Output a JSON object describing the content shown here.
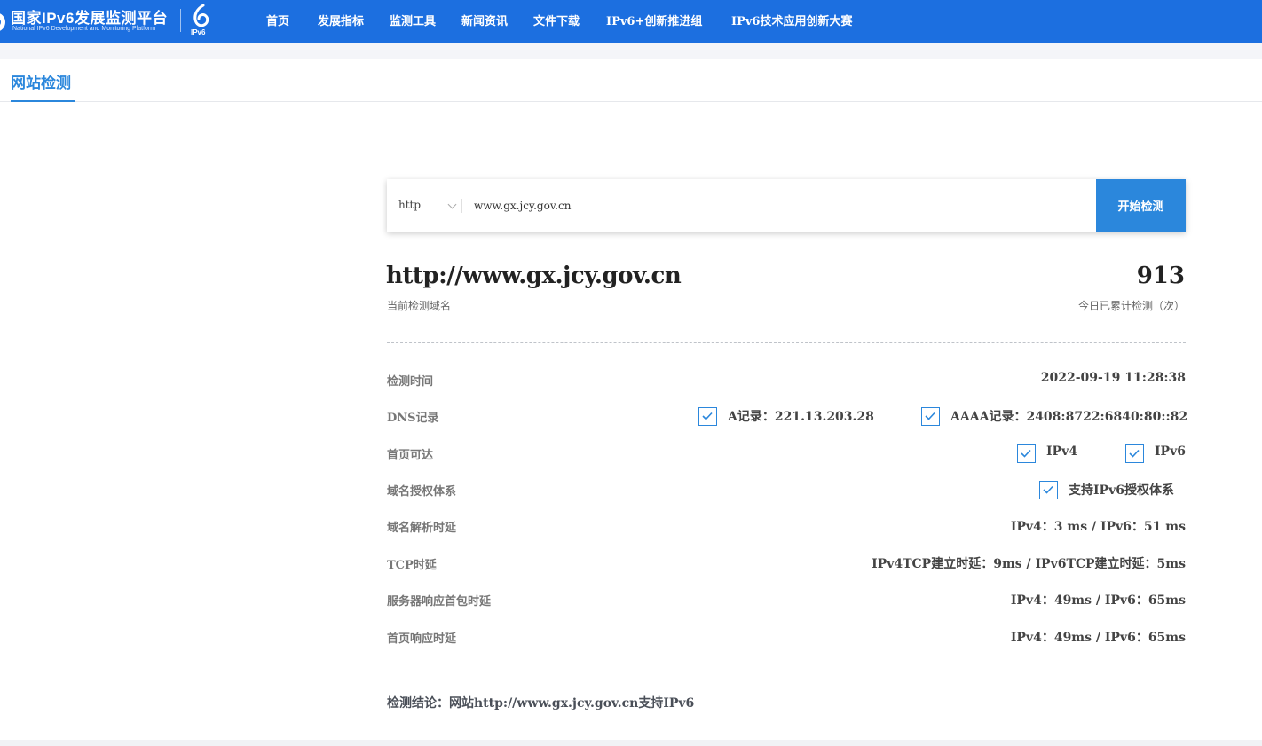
{
  "header": {
    "logo_name": "国家IPv6发展监测平台",
    "logo_subtitle": "National IPv6 Development and Monitoring Platform",
    "logo_mark_text": "IPv6",
    "nav": [
      {
        "label": "首页"
      },
      {
        "label": "发展指标"
      },
      {
        "label": "监测工具"
      },
      {
        "label": "新闻资讯"
      },
      {
        "label": "文件下载"
      },
      {
        "label": "IPv6+创新推进组"
      },
      {
        "label": "IPv6技术应用创新大赛"
      }
    ],
    "color": "#1c6fe0"
  },
  "tabs": {
    "active_label": "网站检测",
    "accent_color": "#2b87dc"
  },
  "search": {
    "protocol": "http",
    "url_value": "www.gx.jcy.gov.cn",
    "button_label": "开始检测"
  },
  "result": {
    "url": "http://www.gx.jcy.gov.cn",
    "url_caption": "当前检测域名",
    "count": "913",
    "count_caption": "今日已累计检测（次）",
    "rows": {
      "time": {
        "label": "检测时间",
        "value": "2022-09-19 11:28:38"
      },
      "dns": {
        "label": "DNS记录",
        "a_record": "A记录：221.13.203.28",
        "aaaa_record": "AAAA记录：2408:8722:6840:80::82"
      },
      "homepage": {
        "label": "首页可达",
        "ipv4": "IPv4",
        "ipv6": "IPv6"
      },
      "auth": {
        "label": "域名授权体系",
        "value": "支持IPv6授权体系"
      },
      "resolve": {
        "label": "域名解析时延",
        "value": "IPv4：3 ms / IPv6：51 ms"
      },
      "tcp": {
        "label": "TCP时延",
        "value": "IPv4TCP建立时延：9ms / IPv6TCP建立时延：5ms"
      },
      "first_packet": {
        "label": "服务器响应首包时延",
        "value": "IPv4：49ms / IPv6：65ms"
      },
      "homepage_latency": {
        "label": "首页响应时延",
        "value": "IPv4：49ms / IPv6：65ms"
      }
    },
    "conclusion": "检测结论：网站http://www.gx.jcy.gov.cn支持IPv6"
  },
  "icons": {
    "checkbox": "check-icon",
    "dropdown": "chevron-down-icon"
  }
}
